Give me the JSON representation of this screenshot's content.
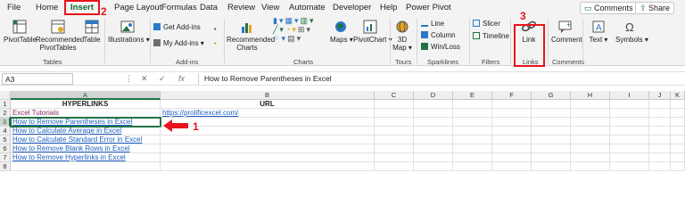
{
  "tabs": [
    "File",
    "Home",
    "Insert",
    "Page Layout",
    "Formulas",
    "Data",
    "Review",
    "View",
    "Automate",
    "Developer",
    "Help",
    "Power Pivot"
  ],
  "active_tab": "Insert",
  "header_buttons": {
    "comments": "Comments",
    "share": "Share"
  },
  "annotations": {
    "one": "1",
    "two": "2",
    "three": "3"
  },
  "ribbon": {
    "pivottable": "PivotTable",
    "recommended_pivottables": [
      "Recommended",
      "PivotTables"
    ],
    "table": "Table",
    "group_tables": "Tables",
    "illustrations": "Illustrations",
    "get_addins": "Get Add-ins",
    "my_addins": "My Add-ins",
    "group_addins": "Add-ins",
    "recommended_charts": [
      "Recommended",
      "Charts"
    ],
    "maps": "Maps",
    "pivotchart": "PivotChart",
    "group_charts": "Charts",
    "map3d": [
      "3D",
      "Map"
    ],
    "group_tours": "Tours",
    "line": "Line",
    "column": "Column",
    "winloss": "Win/Loss",
    "group_sparklines": "Sparklines",
    "slicer": "Slicer",
    "timeline": "Timeline",
    "group_filters": "Filters",
    "link": "Link",
    "group_links": "Links",
    "comment": "Comment",
    "group_comments": "Comments",
    "text": "Text",
    "symbols": "Symbols"
  },
  "formula_bar": {
    "name_box": "A3",
    "fx": "fx",
    "content": "How to Remove Parentheses in Excel"
  },
  "columns": [
    "A",
    "B",
    "C",
    "D",
    "E",
    "F",
    "G",
    "H",
    "I",
    "J",
    "K"
  ],
  "rows": [
    "1",
    "2",
    "3",
    "4",
    "5",
    "6",
    "7",
    "8"
  ],
  "cells": {
    "A1": "HYPERLINKS",
    "B1": "URL",
    "A2": "Excel Tutorials",
    "B2": "https://prolificexcel.com/",
    "A3": "How to Remove Parentheses in Excel",
    "A4": "How to Calculate Average in Excel",
    "A5": "How to Calculate Standard Error in Excel",
    "A6": "How to Remove Blank Rows in Excel",
    "A7": "How to Remove Hyperlinks in Excel"
  },
  "colors": {
    "accent": "#217346",
    "annotation": "#e8141b",
    "link": "#1f5fbf"
  }
}
